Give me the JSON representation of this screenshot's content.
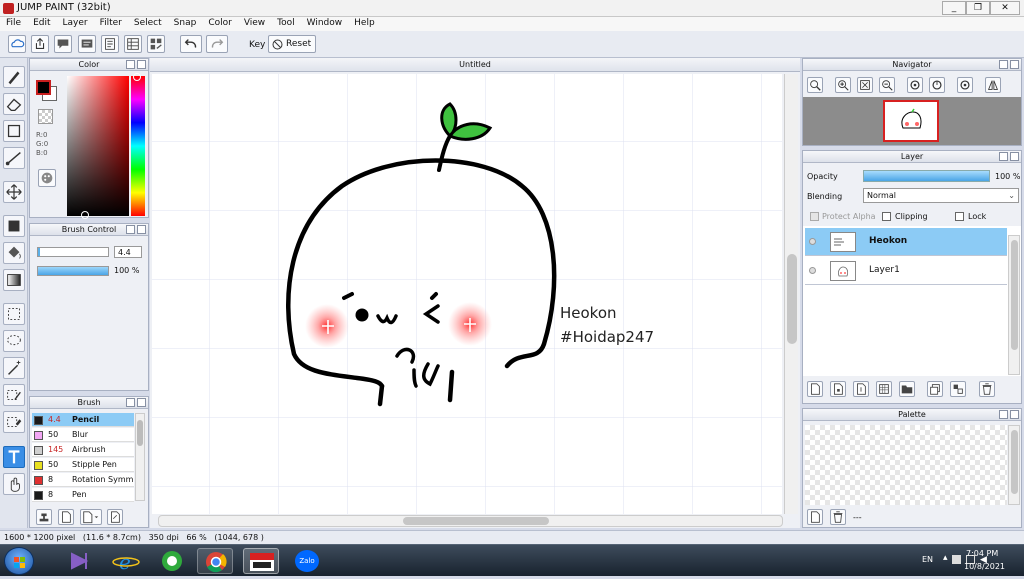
{
  "window": {
    "title": "JUMP PAINT (32bit)",
    "buttons": [
      "_",
      "❐",
      "✕"
    ]
  },
  "menu": [
    "File",
    "Edit",
    "Layer",
    "Filter",
    "Select",
    "Snap",
    "Color",
    "View",
    "Tool",
    "Window",
    "Help"
  ],
  "toolbar": {
    "key_label": "Key",
    "reset_label": "Reset"
  },
  "color_panel": {
    "title": "Color",
    "r": "R:0",
    "g": "G:0",
    "b": "B:0",
    "fg": "#000000",
    "bg": "#ffffff"
  },
  "brush_control": {
    "title": "Brush Control",
    "size": "4.4",
    "opacity": "100 %",
    "opacity_fraction": 1.0
  },
  "brush_panel": {
    "title": "Brush",
    "items": [
      {
        "color": "#1a1a1a",
        "size": "4.4",
        "name": "Pencil",
        "selected": true
      },
      {
        "color": "#f3a7f5",
        "size": "50",
        "name": "Blur"
      },
      {
        "color": "#cfcfcf",
        "size": "145",
        "name": "Airbrush"
      },
      {
        "color": "#e8e020",
        "size": "50",
        "name": "Stipple Pen"
      },
      {
        "color": "#e03030",
        "size": "8",
        "name": "Rotation Symm"
      },
      {
        "color": "#1a1a1a",
        "size": "8",
        "name": "Pen"
      }
    ]
  },
  "document": {
    "tab": "Untitled",
    "caption_line1": "Heokon",
    "caption_line2": "#Hoidap247"
  },
  "navigator": {
    "title": "Navigator"
  },
  "layer_panel": {
    "title": "Layer",
    "opacity_label": "Opacity",
    "opacity_value": "100 %",
    "opacity_fraction": 1.0,
    "blending_label": "Blending",
    "blending_value": "Normal",
    "protect_alpha": "Protect Alpha",
    "clipping": "Clipping",
    "lock": "Lock",
    "layers": [
      {
        "name": "Heokon",
        "selected": true
      },
      {
        "name": "Layer1"
      }
    ]
  },
  "palette": {
    "title": "Palette",
    "footer": "---"
  },
  "status": {
    "text": "1600 * 1200 pixel   (11.6 * 8.7cm)   350 dpi   66 %   (1044, 678 )"
  },
  "tray": {
    "lang": "EN",
    "time": "7:04 PM",
    "date": "10/8/2021",
    "zalo": "Zalo"
  }
}
